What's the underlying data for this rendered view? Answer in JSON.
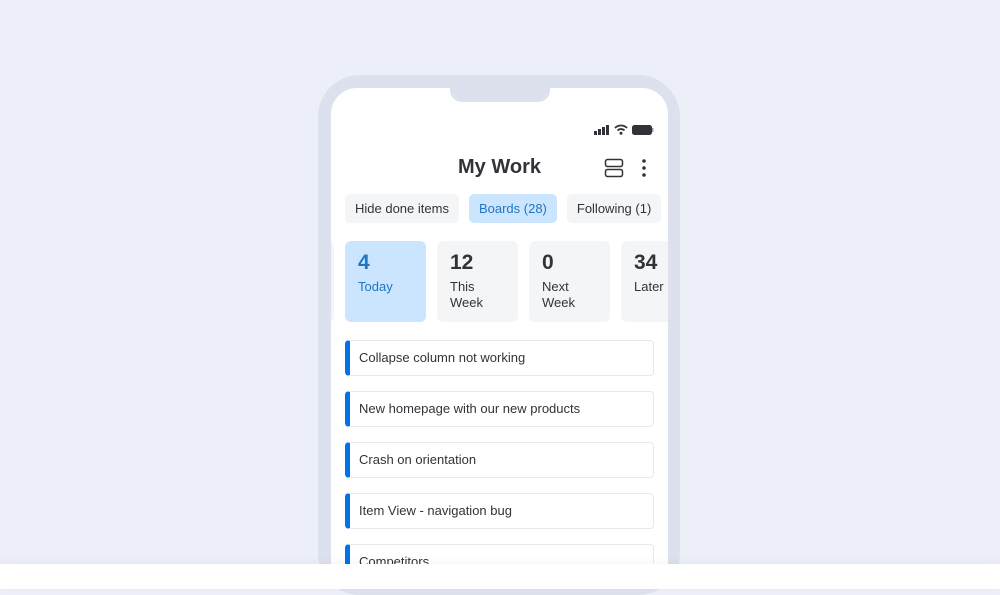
{
  "header": {
    "title": "My Work",
    "icons": [
      "layout-icon",
      "more-vertical-icon"
    ]
  },
  "status_bar": {
    "icons": [
      "signal-icon",
      "wifi-icon",
      "battery-icon"
    ]
  },
  "chips": [
    {
      "label": "Hide done items",
      "active": false
    },
    {
      "label": "Boards (28)",
      "active": true
    },
    {
      "label": "Following (1)",
      "active": false
    }
  ],
  "cards": [
    {
      "num": "",
      "label": ""
    },
    {
      "num": "4",
      "label": "Today",
      "active": true
    },
    {
      "num": "12",
      "label": "This Week"
    },
    {
      "num": "0",
      "label": "Next Week"
    },
    {
      "num": "34",
      "label": "Later"
    }
  ],
  "items": [
    "Collapse column not working",
    "New homepage with our new products",
    "Crash on orientation",
    "Item View - navigation bug",
    "Competitors"
  ],
  "colors": {
    "accent": "#0073EA",
    "active_bg": "#CCE5FF",
    "active_text": "#1F76C2"
  }
}
